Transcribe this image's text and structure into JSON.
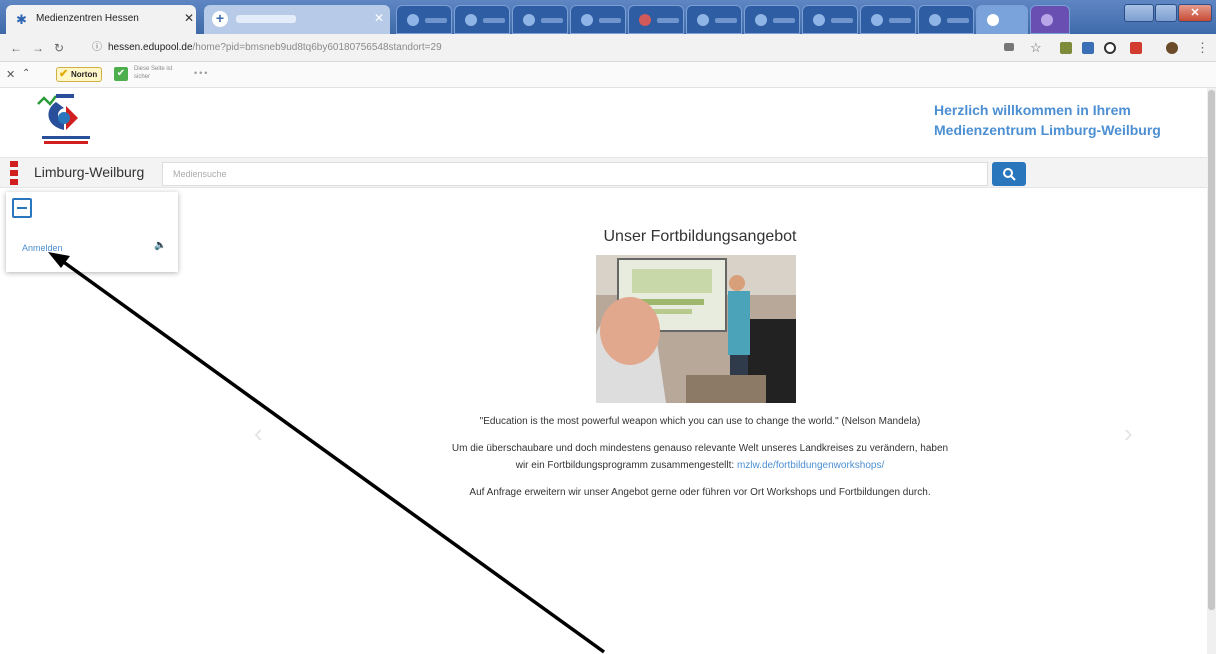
{
  "browser": {
    "active_tab_title": "Medienzentren Hessen",
    "url_host": "hessen.edupool.de",
    "url_path": "/home?pid=bmsneb9ud8tq6by60180756548standort=29"
  },
  "bookmarks": {
    "norton_label": "Norton",
    "safe_label": "Diese Seite ist sicher"
  },
  "header": {
    "welcome_line1": "Herzlich willkommen in Ihrem",
    "welcome_line2": "Medienzentrum Limburg-Weilburg",
    "logo_text": "Medienzentrum Limburg-Weilburg"
  },
  "nav": {
    "brand": "Limburg-Weilburg",
    "search_placeholder": "Mediensuche"
  },
  "popover": {
    "login_label": "Anmelden"
  },
  "main": {
    "title": "Unser Fortbildungsangebot",
    "quote": "\"Education is the most powerful weapon which you can use to change the world.\" (Nelson Mandela)",
    "para_line1": "Um die überschaubare und doch mindestens genauso relevante Welt unseres Landkreises zu verändern, haben",
    "para_line2_prefix": "wir ein Fortbildungsprogramm zusammengestellt: ",
    "para_link": "mzlw.de/fortbildungenworkshops/",
    "para2": "Auf Anfrage erweitern wir unser Angebot gerne oder führen vor Ort Workshops und Fortbildungen durch."
  },
  "colors": {
    "accent": "#2a76bd",
    "welcome": "#4c8fd3",
    "menu_red": "#d11f1f"
  }
}
